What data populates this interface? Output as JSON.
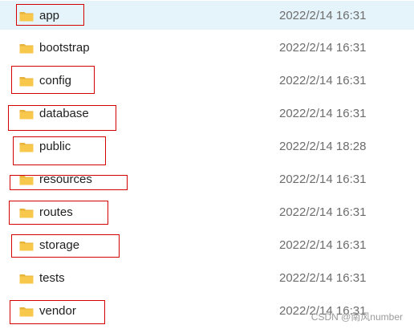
{
  "rows": [
    {
      "name": "app",
      "date": "2022/2/14 16:31"
    },
    {
      "name": "bootstrap",
      "date": "2022/2/14 16:31"
    },
    {
      "name": "config",
      "date": "2022/2/14 16:31"
    },
    {
      "name": "database",
      "date": "2022/2/14 16:31"
    },
    {
      "name": "public",
      "date": "2022/2/14 18:28"
    },
    {
      "name": "resources",
      "date": "2022/2/14 16:31"
    },
    {
      "name": "routes",
      "date": "2022/2/14 16:31"
    },
    {
      "name": "storage",
      "date": "2022/2/14 16:31"
    },
    {
      "name": "tests",
      "date": "2022/2/14 16:31"
    },
    {
      "name": "vendor",
      "date": "2022/2/14 16:31"
    }
  ],
  "watermark": "CSDN @南风number",
  "colors": {
    "selected_row": "#e5f3fb",
    "annotation_box": "#d40000",
    "folder": "#f8c84c"
  },
  "icons": {
    "folder": "folder-icon"
  }
}
